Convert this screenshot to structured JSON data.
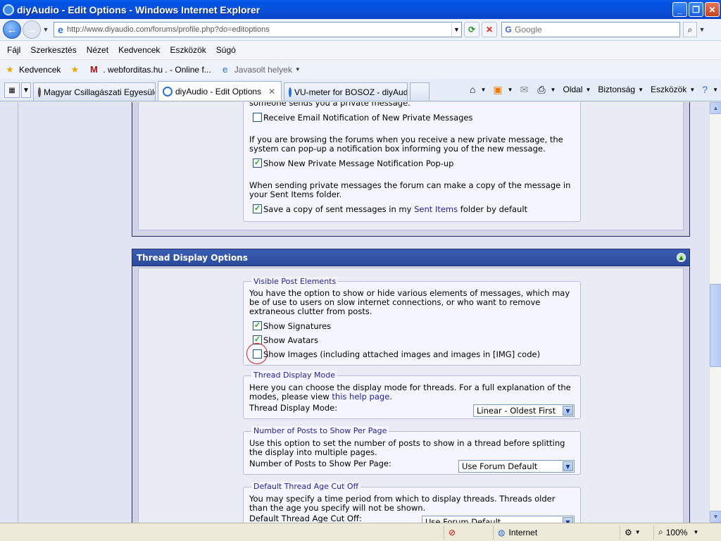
{
  "window": {
    "title": "diyAudio - Edit Options - Windows Internet Explorer"
  },
  "address": {
    "url": "http://www.diyaudio.com/forums/profile.php?do=editoptions"
  },
  "search": {
    "placeholder": "Google"
  },
  "menu": {
    "items": [
      "Fájl",
      "Szerkesztés",
      "Nézet",
      "Kedvencek",
      "Eszközök",
      "Súgó"
    ]
  },
  "favorites": {
    "label": "Kedvencek",
    "items": [
      ". webforditas.hu . - Online f...",
      "Javasolt helyek"
    ]
  },
  "tabs": [
    {
      "label": "Magyar Csillagászati Egyesület",
      "active": false
    },
    {
      "label": "diyAudio - Edit Options",
      "active": true
    },
    {
      "label": "VU-meter for BOSOZ - diyAudio",
      "active": false
    }
  ],
  "commandbar": {
    "page": "Oldal",
    "security": "Biztonság",
    "tools": "Eszközök"
  },
  "private_messages": {
    "partial_line": "someone sends you a private message.",
    "email_notify_label": "Receive Email Notification of New Private Messages",
    "email_notify_checked": false,
    "popup_desc_1": "If you are browsing the forums when you receive a new private message, the",
    "popup_desc_2": "system can pop-up a notification box informing you of the new message.",
    "popup_label": "Show New Private Message Notification Pop-up",
    "popup_checked": true,
    "copy_desc_1": "When sending private messages the forum can make a copy of the message in",
    "copy_desc_2": "your Sent Items folder.",
    "copy_label_pre": "Save a copy of sent messages in my",
    "copy_label_link": "Sent Items",
    "copy_label_post": "folder by default",
    "copy_checked": true
  },
  "thread_display": {
    "header": "Thread Display Options",
    "visible_elements": {
      "legend": "Visible Post Elements",
      "desc_1": "You have the option to show or hide various elements of messages, which may",
      "desc_2": "be of use to users on slow internet connections, or who want to remove",
      "desc_3": "extraneous clutter from posts.",
      "signatures_label": "Show Signatures",
      "signatures_checked": true,
      "avatars_label": "Show Avatars",
      "avatars_checked": true,
      "images_label": "Show Images (including attached images and images in [IMG] code)",
      "images_checked": false
    },
    "mode": {
      "legend": "Thread Display Mode",
      "desc_1": "Here you can choose the display mode for threads. For a full explanation of the",
      "desc_2_pre": "modes, please view",
      "desc_2_link": "this help page",
      "desc_2_post": ".",
      "label": "Thread Display Mode:",
      "value": "Linear - Oldest First"
    },
    "posts_per_page": {
      "legend": "Number of Posts to Show Per Page",
      "desc_1": "Use this option to set the number of posts to show in a thread before splitting",
      "desc_2": "the display into multiple pages.",
      "label": "Number of Posts to Show Per Page:",
      "value": "Use Forum Default"
    },
    "age_cutoff": {
      "legend": "Default Thread Age Cut Off",
      "desc_1": "You may specify a time period from which to display threads. Threads older",
      "desc_2": "than the age you specify will not be shown.",
      "label": "Default Thread Age Cut Off:",
      "value": "Use Forum Default"
    }
  },
  "status": {
    "zone": "Internet",
    "zoom": "100%"
  }
}
